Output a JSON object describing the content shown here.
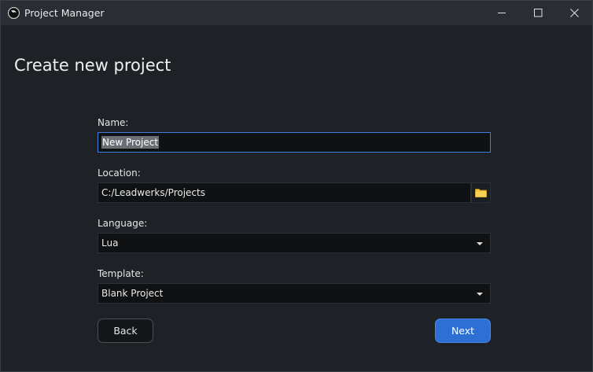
{
  "window": {
    "title": "Project Manager",
    "app_icon": "leadwerks-logo-icon",
    "controls": [
      "minimize-icon",
      "maximize-icon",
      "close-icon"
    ]
  },
  "page": {
    "heading": "Create new project"
  },
  "form": {
    "name": {
      "label": "Name:",
      "value": "New Project"
    },
    "location": {
      "label": "Location:",
      "value": "C:/Leadwerks/Projects",
      "browse_icon": "folder-icon"
    },
    "language": {
      "label": "Language:",
      "value": "Lua"
    },
    "template": {
      "label": "Template:",
      "value": "Blank Project"
    }
  },
  "buttons": {
    "back_label": "Back",
    "next_label": "Next"
  },
  "colors": {
    "background": "#1e2125",
    "titlebar": "#2a2e34",
    "field_bg": "#0f1113",
    "focus_border": "#3d7fd9",
    "primary_button": "#2e6fd6",
    "folder_icon": "#f0c030"
  }
}
